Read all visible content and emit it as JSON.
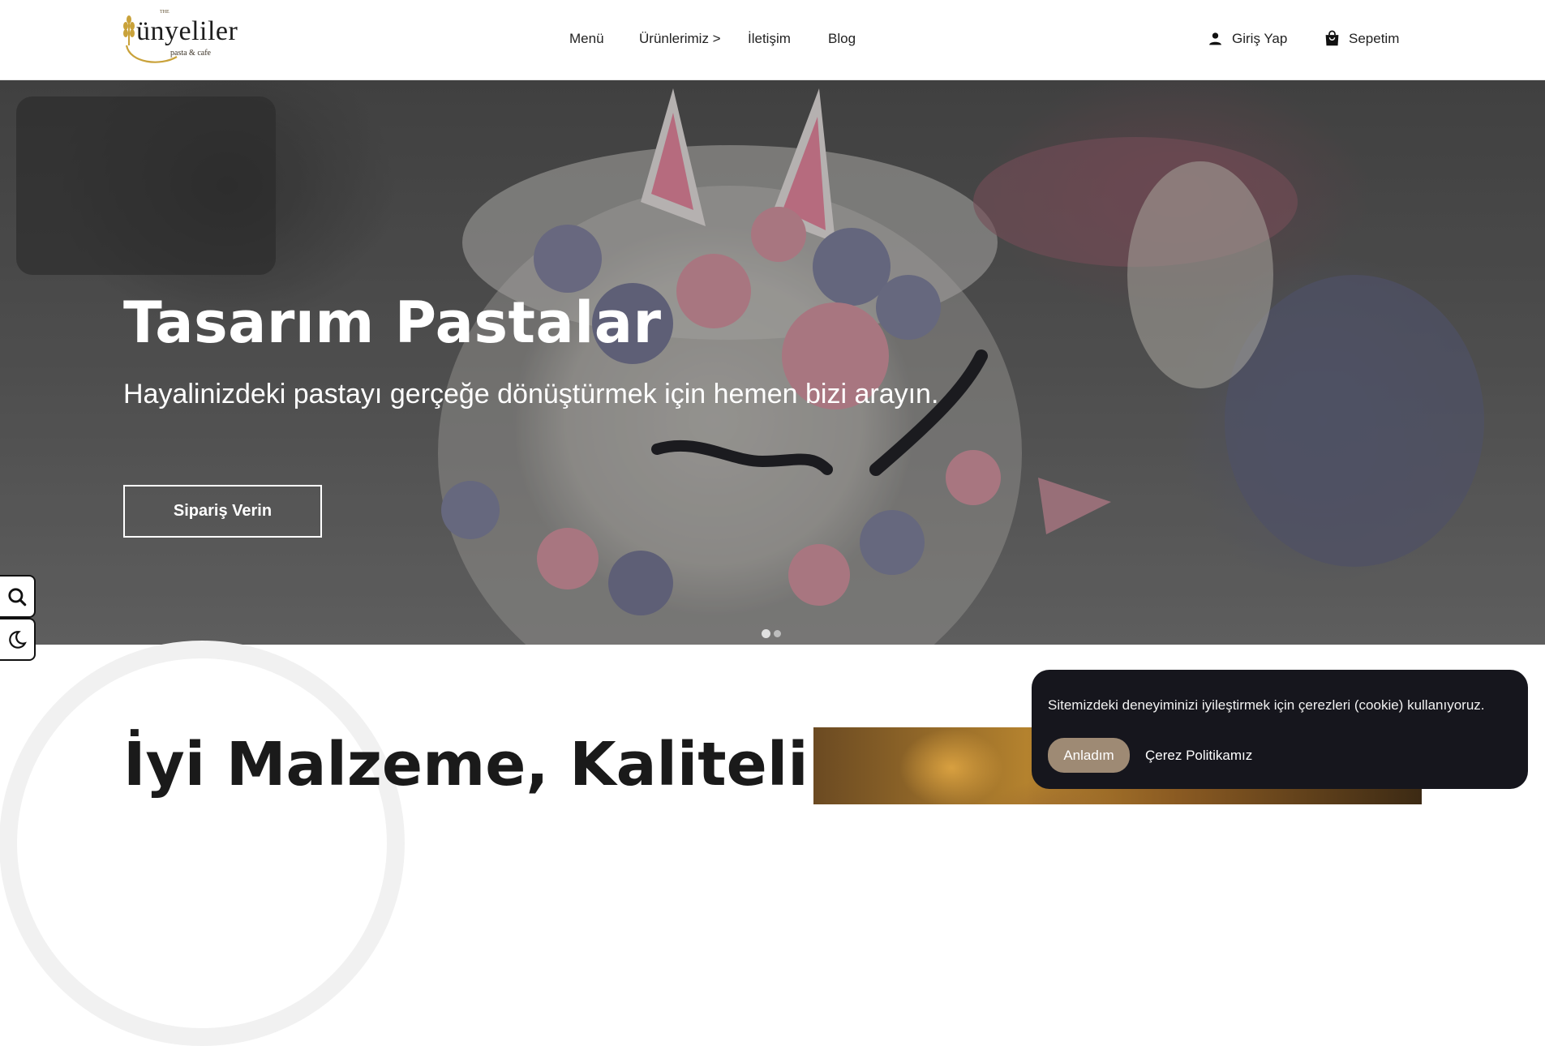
{
  "brand": {
    "small_text": "THE",
    "name": "ünyeliler",
    "tagline": "pasta & cafe",
    "gold": "#c9a23a"
  },
  "nav": {
    "items": [
      "Menü",
      "Ürünlerimiz >",
      "İletişim",
      "Blog"
    ]
  },
  "account": {
    "login_label": "Giriş Yap",
    "login_icon": "person-icon",
    "cart_label": "Sepetim",
    "cart_icon": "shopping-bag-icon"
  },
  "hero": {
    "title": "Tasarım Pastalar",
    "subtitle": "Hayalinizdeki pastayı gerçeğe dönüştürmek için hemen bizi arayın.",
    "cta_label": "Sipariş Verin",
    "slide_count": 2,
    "active_slide": 1
  },
  "side_tools": {
    "search_icon": "search-icon",
    "theme_icon": "moon-icon"
  },
  "section": {
    "title": "İyi Malzeme, Kaliteli"
  },
  "cookie": {
    "message": "Sitemizdeki deneyiminizi iyileştirmek için çerezleri (cookie) kullanıyoruz.",
    "accept_label": "Anladım",
    "policy_label": "Çerez Politikamız",
    "accept_color": "#9e8a74",
    "background": "#16161d"
  }
}
